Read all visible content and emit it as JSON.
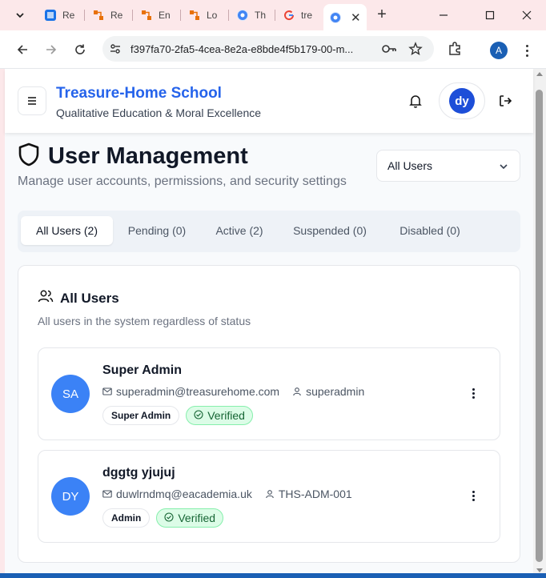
{
  "browser": {
    "tabs": [
      {
        "label": "Re",
        "icon": "document-icon",
        "color": "#1a73e8"
      },
      {
        "label": "Re",
        "icon": "workflow-icon",
        "color": "#e8710a"
      },
      {
        "label": "En",
        "icon": "workflow-icon",
        "color": "#e8710a"
      },
      {
        "label": "Lo",
        "icon": "workflow-icon",
        "color": "#e8710a"
      },
      {
        "label": "Th",
        "icon": "chrome-icon",
        "color": "#4285f4"
      },
      {
        "label": "tre",
        "icon": "google-icon",
        "color": "#4285f4"
      },
      {
        "label": "",
        "icon": "chrome-icon",
        "color": "#4285f4",
        "active": true
      }
    ],
    "url": "f397fa70-2fa5-4cea-8e2a-e8bde4f5b179-00-m...",
    "profile_initial": "A"
  },
  "header": {
    "school_name": "Treasure-Home School",
    "tagline": "Qualitative Education & Moral Excellence",
    "avatar_initials": "dy"
  },
  "page": {
    "title": "User Management",
    "subtitle": "Manage user accounts, permissions, and security settings",
    "filter_value": "All Users",
    "tabs": [
      {
        "label": "All Users (2)",
        "active": true
      },
      {
        "label": "Pending (0)"
      },
      {
        "label": "Active (2)"
      },
      {
        "label": "Suspended (0)"
      },
      {
        "label": "Disabled (0)"
      }
    ]
  },
  "users_card": {
    "title": "All Users",
    "description": "All users in the system regardless of status",
    "users": [
      {
        "initials": "SA",
        "name": "Super Admin",
        "email": "superadmin@treasurehome.com",
        "username": "superadmin",
        "role": "Super Admin",
        "status": "Verified"
      },
      {
        "initials": "DY",
        "name": "dggtg yjujuj",
        "email": "duwlrndmq@eacademia.uk",
        "username": "THS-ADM-001",
        "role": "Admin",
        "status": "Verified"
      }
    ]
  },
  "colors": {
    "brand": "#2563eb",
    "avatar": "#3b82f6",
    "verified_bg": "#dcfce7",
    "verified_text": "#166534",
    "tabbar": "#fce8ea"
  }
}
